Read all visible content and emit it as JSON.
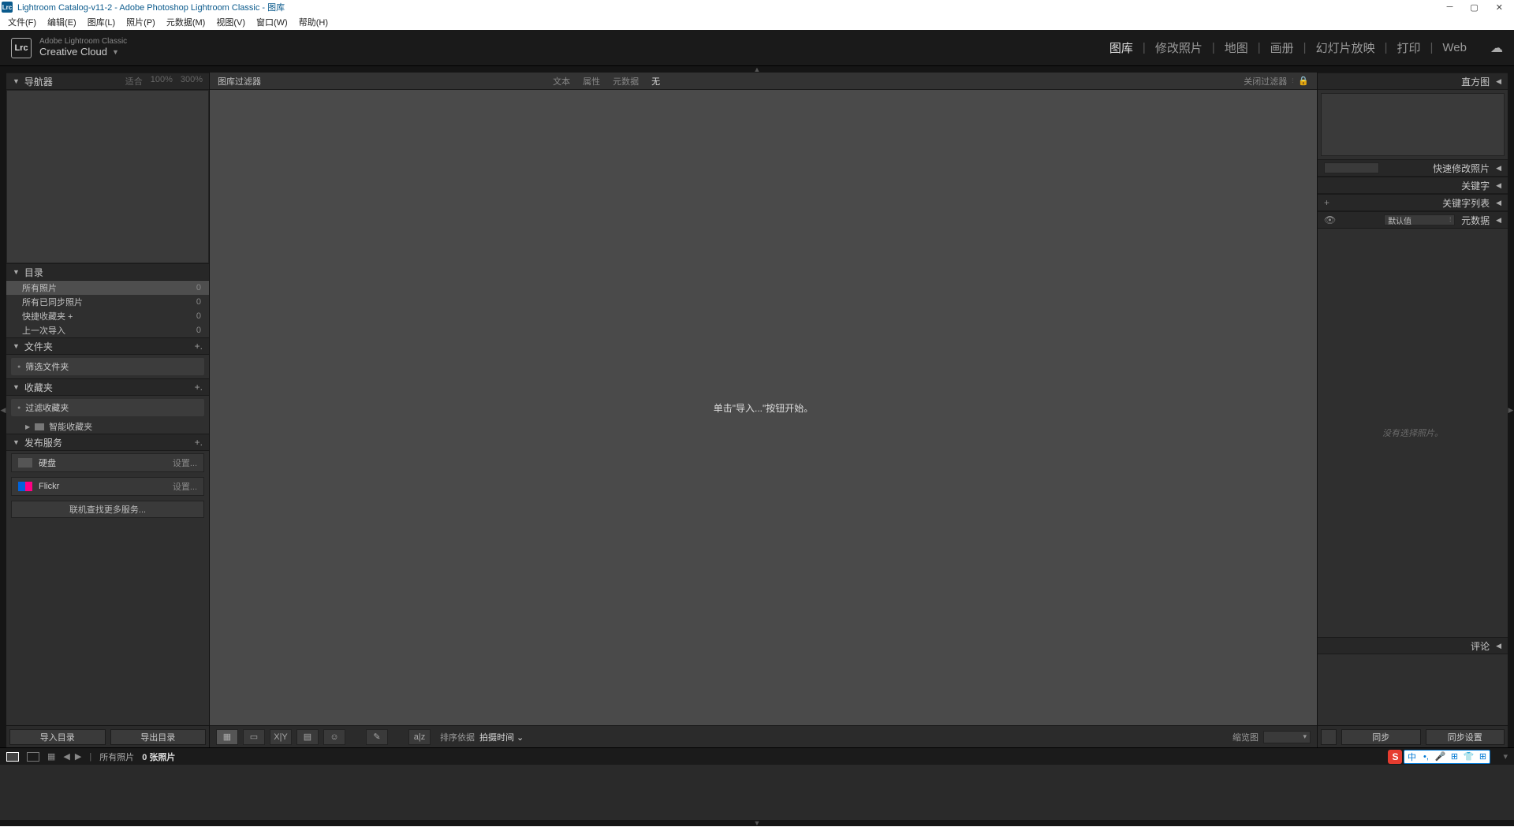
{
  "window": {
    "title": "Lightroom Catalog-v11-2 - Adobe Photoshop Lightroom Classic - 图库",
    "logo": "Lrc"
  },
  "menubar": [
    "文件(F)",
    "编辑(E)",
    "图库(L)",
    "照片(P)",
    "元数据(M)",
    "视图(V)",
    "窗口(W)",
    "帮助(H)"
  ],
  "brand": {
    "line1": "Adobe Lightroom Classic",
    "line2": "Creative Cloud"
  },
  "modules": [
    {
      "label": "图库",
      "active": true
    },
    {
      "label": "修改照片"
    },
    {
      "label": "地图"
    },
    {
      "label": "画册"
    },
    {
      "label": "幻灯片放映"
    },
    {
      "label": "打印"
    },
    {
      "label": "Web"
    }
  ],
  "left": {
    "navigator": {
      "title": "导航器",
      "fit": "适合",
      "p100": "100%",
      "p300": "300%"
    },
    "catalog": {
      "title": "目录",
      "rows": [
        {
          "label": "所有照片",
          "count": "0",
          "selected": true
        },
        {
          "label": "所有已同步照片",
          "count": "0"
        },
        {
          "label": "快捷收藏夹 +",
          "count": "0"
        },
        {
          "label": "上一次导入",
          "count": "0"
        }
      ]
    },
    "folders": {
      "title": "文件夹",
      "search": "筛选文件夹"
    },
    "collections": {
      "title": "收藏夹",
      "search": "过滤收藏夹",
      "smart": "智能收藏夹"
    },
    "publish": {
      "title": "发布服务",
      "hd": "硬盘",
      "flickr": "Flickr",
      "set": "设置...",
      "more": "联机查找更多服务..."
    },
    "import": "导入目录",
    "export": "导出目录"
  },
  "center": {
    "filter": {
      "title": "图库过滤器",
      "tabs": [
        "文本",
        "属性",
        "元数据",
        "无"
      ],
      "close": "关闭过滤器"
    },
    "empty": "单击\"导入...\"按钮开始。",
    "toolbar": {
      "sortby": "排序依据",
      "sortval": "拍摄时间",
      "thumb": "缩览图"
    }
  },
  "right": {
    "histogram": "直方图",
    "quick": "快速修改照片",
    "keywords": "关键字",
    "keylist": "关键字列表",
    "metadata": "元数据",
    "preset": "默认值",
    "empty": "没有选择照片。",
    "comments": "评论",
    "sync": "同步",
    "syncset": "同步设置"
  },
  "filmstrip": {
    "allphotos": "所有照片",
    "count": "0 张照片"
  }
}
